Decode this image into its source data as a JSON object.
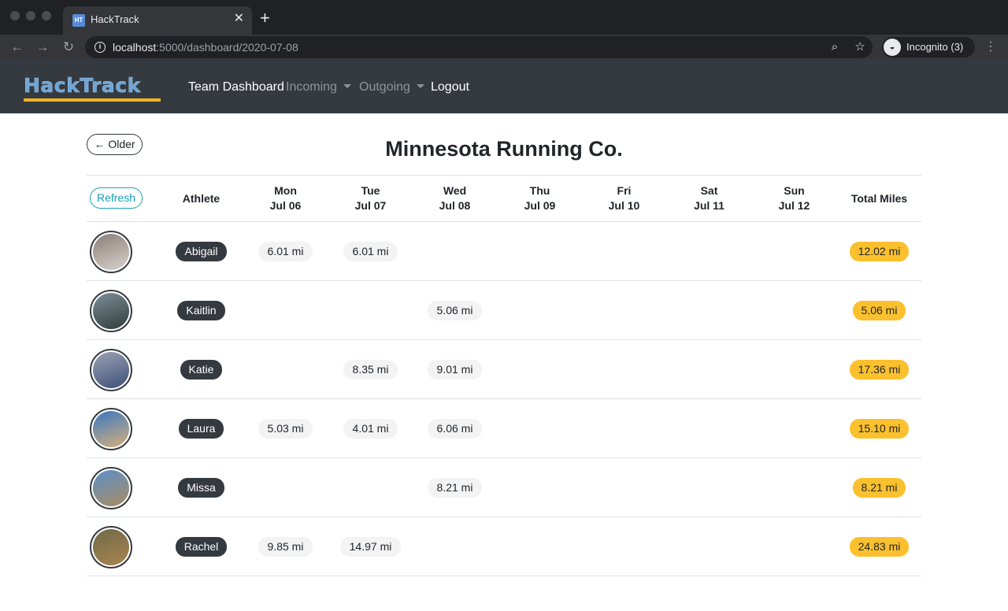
{
  "browser": {
    "tab_title": "HackTrack",
    "tab_favicon": "HT",
    "url_host": "localhost",
    "url_path": ":5000/dashboard/2020-07-08",
    "incognito_label": "Incognito (3)"
  },
  "nav": {
    "brand": "HackTrack",
    "team_dashboard": "Team Dashboard",
    "incoming": "Incoming",
    "outgoing": "Outgoing",
    "logout": "Logout"
  },
  "page": {
    "older_label": "← Older",
    "title": "Minnesota Running Co.",
    "refresh_label": "Refresh"
  },
  "columns": {
    "athlete": "Athlete",
    "total": "Total Miles",
    "days": [
      {
        "day": "Mon",
        "date": "Jul 06"
      },
      {
        "day": "Tue",
        "date": "Jul 07"
      },
      {
        "day": "Wed",
        "date": "Jul 08"
      },
      {
        "day": "Thu",
        "date": "Jul 09"
      },
      {
        "day": "Fri",
        "date": "Jul 10"
      },
      {
        "day": "Sat",
        "date": "Jul 11"
      },
      {
        "day": "Sun",
        "date": "Jul 12"
      }
    ]
  },
  "athletes": [
    {
      "name": "Abigail",
      "miles": [
        "6.01 mi",
        "6.01 mi",
        "",
        "",
        "",
        "",
        ""
      ],
      "total": "12.02 mi",
      "avatar_colors": [
        "#8a7f78",
        "#d8d2cc"
      ]
    },
    {
      "name": "Kaitlin",
      "miles": [
        "",
        "",
        "5.06 mi",
        "",
        "",
        "",
        ""
      ],
      "total": "5.06 mi",
      "avatar_colors": [
        "#7c8e98",
        "#2f3d3a"
      ]
    },
    {
      "name": "Katie",
      "miles": [
        "",
        "8.35 mi",
        "9.01 mi",
        "",
        "",
        "",
        ""
      ],
      "total": "17.36 mi",
      "avatar_colors": [
        "#9aa3b4",
        "#3e4f78"
      ]
    },
    {
      "name": "Laura",
      "miles": [
        "5.03 mi",
        "4.01 mi",
        "6.06 mi",
        "",
        "",
        "",
        ""
      ],
      "total": "15.10 mi",
      "avatar_colors": [
        "#3a77c2",
        "#d7b07a"
      ]
    },
    {
      "name": "Missa",
      "miles": [
        "",
        "",
        "8.21 mi",
        "",
        "",
        "",
        ""
      ],
      "total": "8.21 mi",
      "avatar_colors": [
        "#5d8fc8",
        "#a88c62"
      ]
    },
    {
      "name": "Rachel",
      "miles": [
        "9.85 mi",
        "14.97 mi",
        "",
        "",
        "",
        "",
        ""
      ],
      "total": "24.83 mi",
      "avatar_colors": [
        "#6f6a48",
        "#a98450"
      ]
    }
  ]
}
